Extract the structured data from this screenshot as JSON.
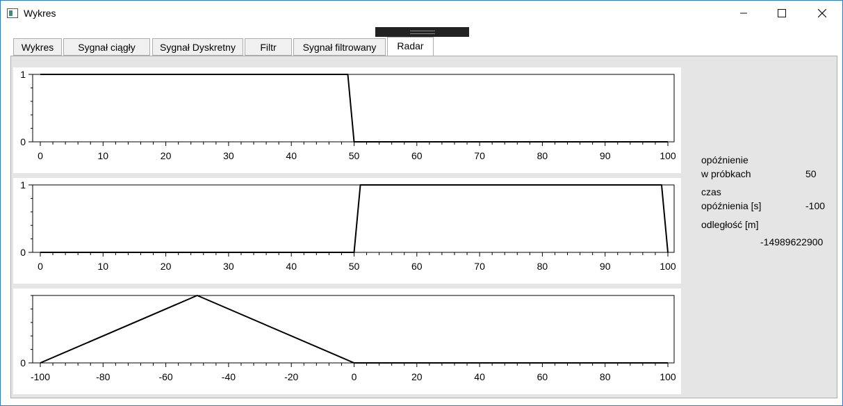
{
  "window": {
    "title": "Wykres",
    "minimize_icon": "minimize-icon",
    "maximize_icon": "maximize-icon",
    "close_icon": "close-icon"
  },
  "tabs": [
    {
      "label": "Wykres"
    },
    {
      "label": "Sygnał ciągły"
    },
    {
      "label": "Sygnał Dyskretny"
    },
    {
      "label": "Filtr"
    },
    {
      "label": "Sygnał filtrowany"
    },
    {
      "label": "Radar",
      "active": true
    }
  ],
  "info": {
    "delay_samples_label_line1": "opóźnienie",
    "delay_samples_label_line2": "w próbkach",
    "delay_samples_value": "50",
    "delay_time_label_line1": "czas",
    "delay_time_label_line2": "opóźnienia [s]",
    "delay_time_value": "-100",
    "distance_label": "odległość [m]",
    "distance_value": "-14989622900"
  },
  "chart_data": [
    {
      "type": "line",
      "x": [
        0,
        49,
        50,
        100
      ],
      "y": [
        1,
        1,
        0,
        0
      ],
      "xlim": [
        0,
        100
      ],
      "ylim": [
        0,
        1
      ],
      "xticks": [
        0,
        10,
        20,
        30,
        40,
        50,
        60,
        70,
        80,
        90,
        100
      ],
      "yticks": [
        0,
        1
      ]
    },
    {
      "type": "line",
      "x": [
        0,
        50,
        51,
        99,
        100
      ],
      "y": [
        0,
        0,
        1,
        1,
        0
      ],
      "xlim": [
        0,
        100
      ],
      "ylim": [
        0,
        1
      ],
      "xticks": [
        0,
        10,
        20,
        30,
        40,
        50,
        60,
        70,
        80,
        90,
        100
      ],
      "yticks": [
        0,
        1
      ]
    },
    {
      "type": "line",
      "x": [
        -100,
        -50,
        0,
        100
      ],
      "y": [
        0,
        1,
        0,
        0
      ],
      "xlim": [
        -100,
        100
      ],
      "ylim": [
        0,
        1
      ],
      "xticks": [
        -100,
        -80,
        -60,
        -40,
        -20,
        0,
        20,
        40,
        60,
        80,
        100
      ],
      "yticks": [
        0
      ]
    }
  ]
}
